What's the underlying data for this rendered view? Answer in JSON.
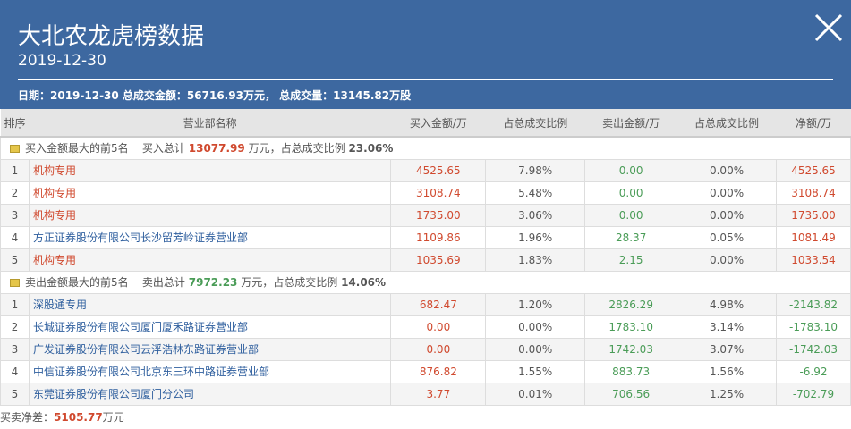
{
  "header": {
    "title": "大北农龙虎榜数据",
    "date": "2019-12-30",
    "info": "日期：2019-12-30 总成交金额：56716.93万元， 总成交量：13145.82万股"
  },
  "columns": [
    "排序",
    "营业部名称",
    "买入金额/万",
    "占总成交比例",
    "卖出金额/万",
    "占总成交比例",
    "净额/万"
  ],
  "buy_section": {
    "label": "买入金额最大的前5名",
    "total_prefix": "买入总计",
    "total": "13077.99",
    "mid": "万元，占总成交比例",
    "ratio": "23.06%"
  },
  "buy_rows": [
    {
      "rank": "1",
      "name": "机构专用",
      "buy": "4525.65",
      "buy_pct": "7.98%",
      "sell": "0.00",
      "sell_pct": "0.00%",
      "net": "4525.65"
    },
    {
      "rank": "2",
      "name": "机构专用",
      "buy": "3108.74",
      "buy_pct": "5.48%",
      "sell": "0.00",
      "sell_pct": "0.00%",
      "net": "3108.74"
    },
    {
      "rank": "3",
      "name": "机构专用",
      "buy": "1735.00",
      "buy_pct": "3.06%",
      "sell": "0.00",
      "sell_pct": "0.00%",
      "net": "1735.00"
    },
    {
      "rank": "4",
      "name": "方正证券股份有限公司长沙留芳岭证券营业部",
      "buy": "1109.86",
      "buy_pct": "1.96%",
      "sell": "28.37",
      "sell_pct": "0.05%",
      "net": "1081.49"
    },
    {
      "rank": "5",
      "name": "机构专用",
      "buy": "1035.69",
      "buy_pct": "1.83%",
      "sell": "2.15",
      "sell_pct": "0.00%",
      "net": "1033.54"
    }
  ],
  "sell_section": {
    "label": "卖出金额最大的前5名",
    "total_prefix": "卖出总计",
    "total": "7972.23",
    "mid": "万元，占总成交比例",
    "ratio": "14.06%"
  },
  "sell_rows": [
    {
      "rank": "1",
      "name": "深股通专用",
      "buy": "682.47",
      "buy_pct": "1.20%",
      "sell": "2826.29",
      "sell_pct": "4.98%",
      "net": "-2143.82"
    },
    {
      "rank": "2",
      "name": "长城证券股份有限公司厦门厦禾路证券营业部",
      "buy": "0.00",
      "buy_pct": "0.00%",
      "sell": "1783.10",
      "sell_pct": "3.14%",
      "net": "-1783.10"
    },
    {
      "rank": "3",
      "name": "广发证券股份有限公司云浮浩林东路证券营业部",
      "buy": "0.00",
      "buy_pct": "0.00%",
      "sell": "1742.03",
      "sell_pct": "3.07%",
      "net": "-1742.03"
    },
    {
      "rank": "4",
      "name": "中信证券股份有限公司北京东三环中路证券营业部",
      "buy": "876.82",
      "buy_pct": "1.55%",
      "sell": "883.73",
      "sell_pct": "1.56%",
      "net": "-6.92"
    },
    {
      "rank": "5",
      "name": "东莞证券股份有限公司厦门分公司",
      "buy": "3.77",
      "buy_pct": "0.01%",
      "sell": "706.56",
      "sell_pct": "1.25%",
      "net": "-702.79"
    }
  ],
  "footer": {
    "label": "买卖净差：",
    "value": "5105.77",
    "unit": "万元"
  },
  "colors": {
    "header": "#3d68a0",
    "up": "#d0492e",
    "down": "#4a9c57",
    "link": "#2f5f9e"
  }
}
